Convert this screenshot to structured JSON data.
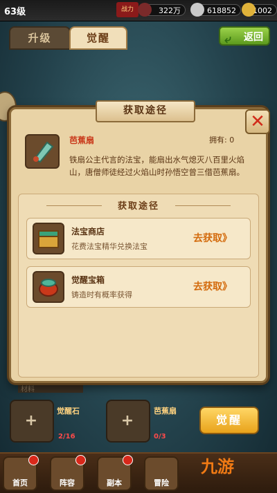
{
  "status_bar": {
    "level": "63级",
    "power_label": "战力",
    "resource_1": "322万",
    "resource_2": "618852",
    "resource_3": "1002"
  },
  "tabs": [
    {
      "label": "升级"
    },
    {
      "label": "觉醒"
    }
  ],
  "back_button": {
    "label": "返回"
  },
  "modal": {
    "title": "获取途径",
    "item": {
      "name": "芭蕉扇",
      "owned": "拥有: 0",
      "description": "铁扇公主代言的法宝，能扇出水气熄灭八百里火焰山，唐僧师徒经过火焰山时孙悟空曾三借芭蕉扇。"
    },
    "sources_title": "获取途径",
    "sources": [
      {
        "name": "法宝商店",
        "desc": "花费法宝精华兑换法宝",
        "action": "去获取》"
      },
      {
        "name": "觉醒宝箱",
        "desc": "铸造时有概率获得",
        "action": "去获取》"
      }
    ]
  },
  "materials": {
    "label": "材料",
    "slots": [
      {
        "name": "觉醒石",
        "count": "2/16"
      },
      {
        "name": "芭蕉扇",
        "count": "0/3"
      }
    ]
  },
  "awaken_button": {
    "label": "觉醒"
  },
  "bottom_nav": [
    {
      "label": "首页"
    },
    {
      "label": "阵容"
    },
    {
      "label": "副本"
    },
    {
      "label": "冒险"
    }
  ],
  "watermark": "九游"
}
